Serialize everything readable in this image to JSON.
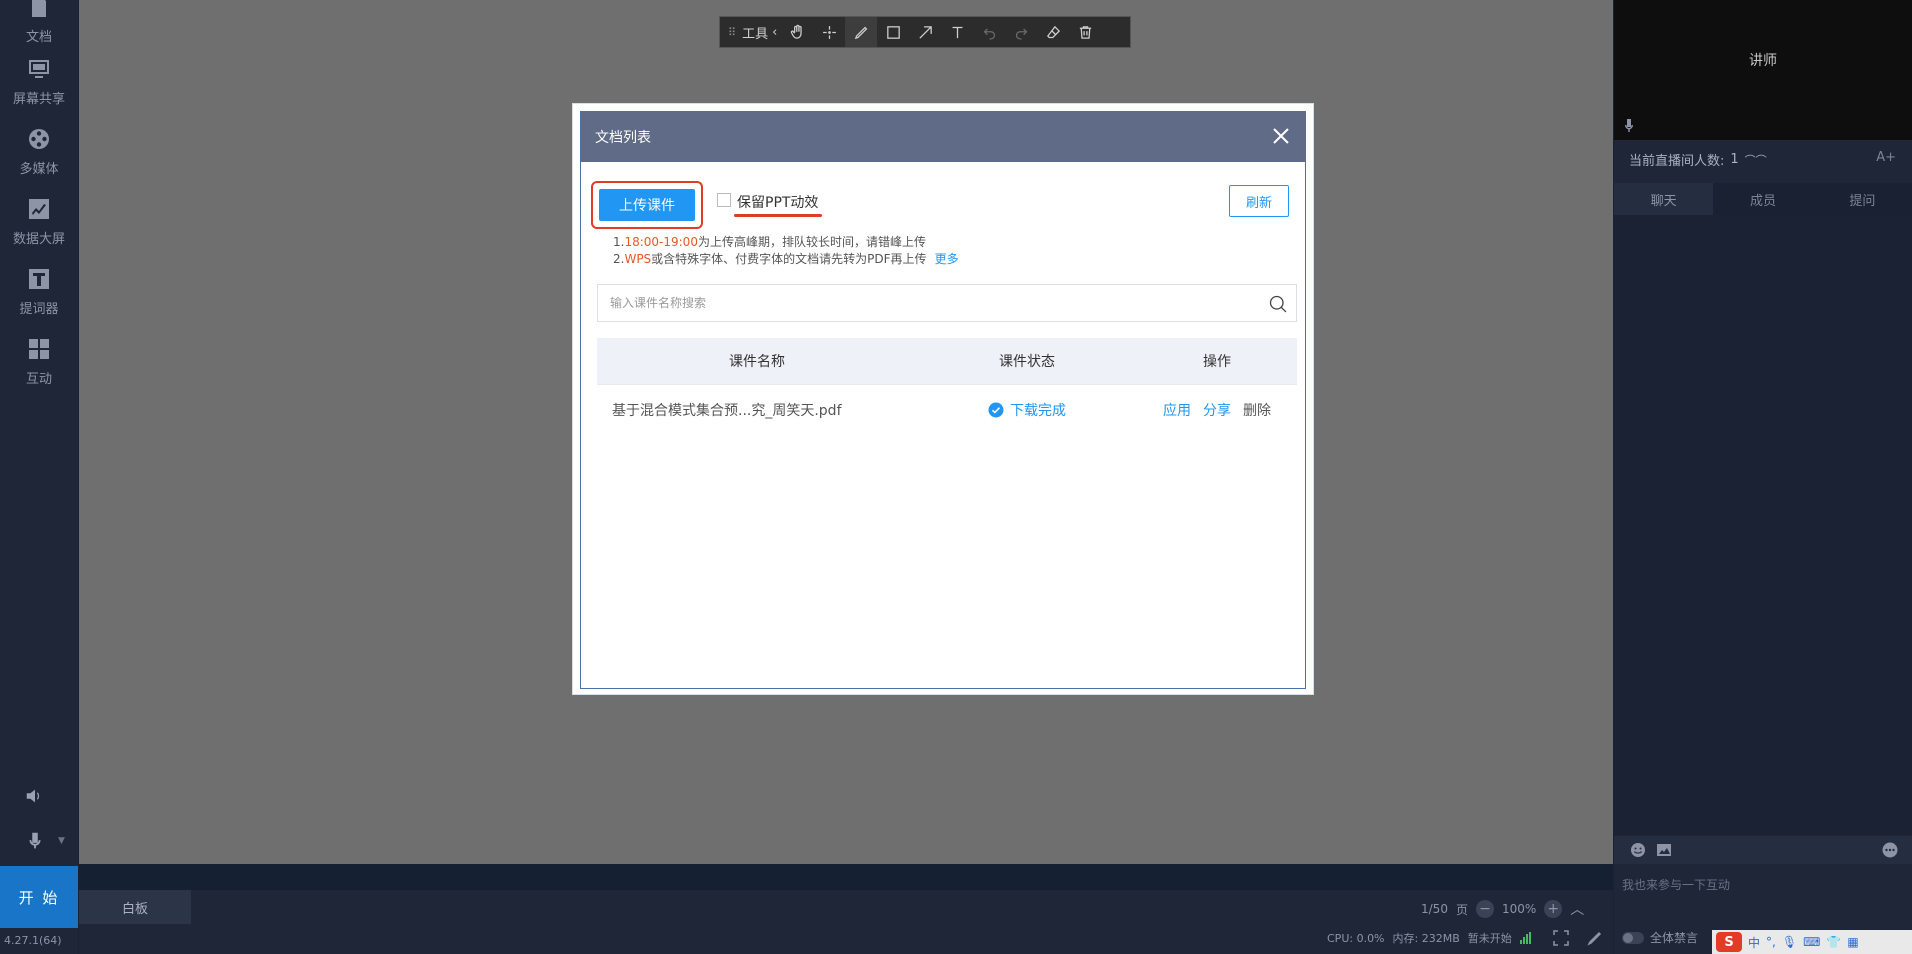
{
  "sidebar": {
    "items": [
      {
        "label": "文档",
        "icon": "document-icon"
      },
      {
        "label": "屏幕共享",
        "icon": "monitor-icon"
      },
      {
        "label": "多媒体",
        "icon": "film-icon"
      },
      {
        "label": "数据大屏",
        "icon": "chart-icon"
      },
      {
        "label": "提词器",
        "icon": "text-icon"
      },
      {
        "label": "互动",
        "icon": "grid-icon"
      }
    ],
    "start_label": "开 始",
    "version": "4.27.1(64)"
  },
  "toolbar": {
    "label": "工具"
  },
  "modal": {
    "title": "文档列表",
    "upload_label": "上传课件",
    "ppt_label": "保留PPT动效",
    "refresh_label": "刷新",
    "tip1_prefix": "1.",
    "tip1_hl": "18:00-19:00",
    "tip1_rest": "为上传高峰期，排队较长时间，请错峰上传",
    "tip2_prefix": "2.",
    "tip2_hl": "WPS",
    "tip2_rest": "或含特殊字体、付费字体的文档请先转为PDF再上传",
    "tip2_more": "更多",
    "search_placeholder": "输入课件名称搜索",
    "columns": [
      "课件名称",
      "课件状态",
      "操作"
    ],
    "rows": [
      {
        "name": "基于混合模式集合预...究_周笑天.pdf",
        "status": "下载完成",
        "ops": [
          "应用",
          "分享",
          "删除"
        ]
      }
    ]
  },
  "bottom": {
    "whiteboard_tab": "白板",
    "page": "1/50",
    "page_unit": "页",
    "zoom": "100%",
    "cpu": "CPU: 0.0%",
    "memory": "内存: 232MB",
    "stream_status": "暂未开始"
  },
  "right": {
    "video_label": "讲师",
    "viewers_label": "当前直播间人数: ",
    "viewers_count": "1",
    "font_btn": "A+",
    "tabs": [
      "聊天",
      "成员",
      "提问"
    ],
    "chat_placeholder": "我也来参与一下互动",
    "mute_label": "全体禁言",
    "ime_label": "中"
  },
  "colors": {
    "accent": "#2196f3",
    "annotation": "#e23b26",
    "modal_header": "#5f6b87"
  }
}
